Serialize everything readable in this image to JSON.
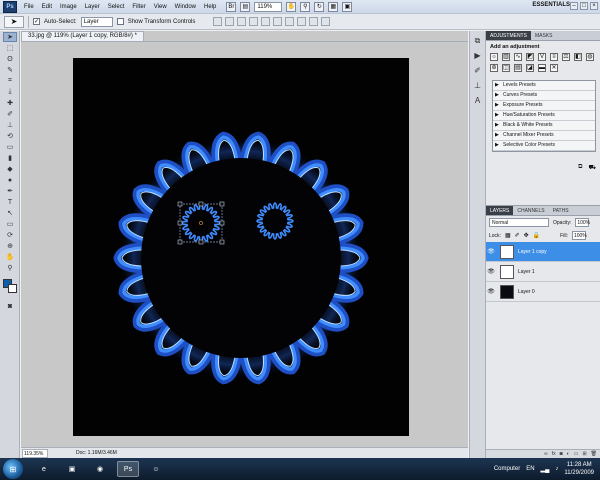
{
  "menubar": {
    "app_icon": "Ps",
    "items": [
      "File",
      "Edit",
      "Image",
      "Layer",
      "Select",
      "Filter",
      "View",
      "Window",
      "Help"
    ],
    "zoom": "119%",
    "workspace": "ESSENTIALS"
  },
  "options": {
    "auto_select_label": "Auto-Select:",
    "auto_select_value": "Layer",
    "transform_label": "Show Transform Controls"
  },
  "document": {
    "tab_title": "33.jpg @ 119% (Layer 1 copy, RGB/8#) *",
    "status_zoom": "119.35%",
    "status_doc": "Doc: 1.16M/3.46M"
  },
  "adjustments": {
    "tabs": [
      "ADJUSTMENTS",
      "MASKS"
    ],
    "title": "Add an adjustment",
    "presets": [
      "Levels Presets",
      "Curves Presets",
      "Exposure Presets",
      "Hue/Saturation Presets",
      "Black & White Presets",
      "Channel Mixer Presets",
      "Selective Color Presets"
    ]
  },
  "layers_panel": {
    "tabs": [
      "LAYERS",
      "CHANNELS",
      "PATHS"
    ],
    "blend_mode": "Normal",
    "opacity_label": "Opacity:",
    "opacity_value": "100%",
    "lock_label": "Lock:",
    "fill_label": "Fill:",
    "fill_value": "100%",
    "layers": [
      {
        "name": "Layer 1 copy",
        "selected": true
      },
      {
        "name": "Layer 1",
        "selected": false
      },
      {
        "name": "Layer 0",
        "selected": false
      }
    ]
  },
  "taskbar": {
    "tray_computer": "Computer",
    "tray_lang": "EN",
    "time": "11:28 AM",
    "date": "11/29/2009"
  },
  "colors": {
    "foreground": "#0c5fa8",
    "layer_selected": "#3d8ee6",
    "flame": "#3f8dff"
  }
}
